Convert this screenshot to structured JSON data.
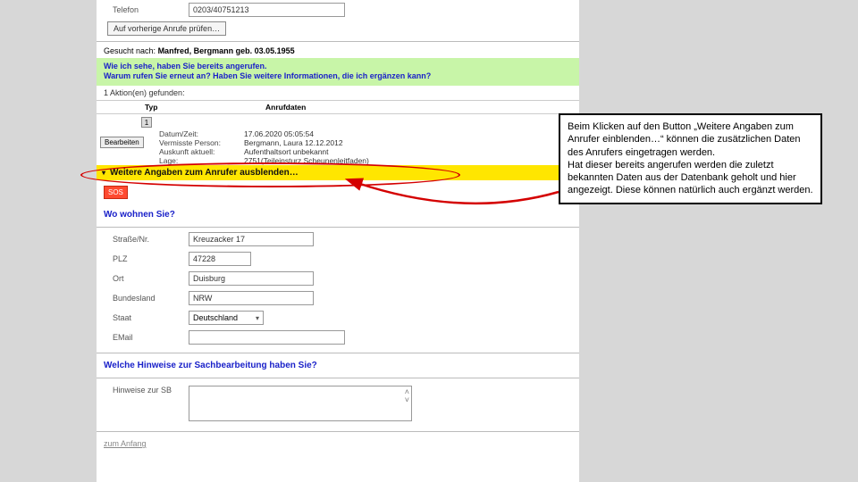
{
  "telefon": {
    "label": "Telefon",
    "value": "0203/40751213"
  },
  "prev_calls_btn": "Auf vorherige Anrufe prüfen…",
  "gesucht_prefix": "Gesucht nach:",
  "gesucht_value": "Manfred, Bergmann geb. 03.05.1955",
  "green_line1": "Wie ich sehe, haben Sie bereits angerufen.",
  "green_line2": "Warum rufen Sie erneut an? Haben Sie weitere Informationen, die ich ergänzen kann?",
  "found_count": "1 Aktion(en) gefunden:",
  "headers": {
    "typ": "Typ",
    "anrufdaten": "Anrufdaten"
  },
  "bearbeiten": "Bearbeiten",
  "detail_icon": "1",
  "details": {
    "datum_k": "Datum/Zeit:",
    "datum_v": "17.06.2020 05:05:54",
    "verm_k": "Vermisste Person:",
    "verm_v": "Bergmann, Laura 12.12.2012",
    "ausk_k": "Auskunft aktuell:",
    "ausk_v": "Aufenthaltsort unbekannt",
    "lage_k": "Lage:",
    "lage_v": "2751(Teileinsturz Scheunenleitfaden)"
  },
  "yellow_label": "Weitere Angaben zum Anrufer ausblenden…",
  "sos": "SOS",
  "section_wohnen": "Wo wohnen Sie?",
  "addr": {
    "strasse_k": "Straße/Nr.",
    "strasse_v": "Kreuzacker 17",
    "plz_k": "PLZ",
    "plz_v": "47228",
    "ort_k": "Ort",
    "ort_v": "Duisburg",
    "land_k": "Bundesland",
    "land_v": "NRW",
    "staat_k": "Staat",
    "staat_v": "Deutschland",
    "email_k": "EMail",
    "email_v": ""
  },
  "section_hinweise": "Welche Hinweise zur Sachbearbeitung haben Sie?",
  "hinweise_k": "Hinweise zur SB",
  "zum_anfang": "zum Anfang",
  "callout": "Beim Klicken auf den Button „Weitere Angaben zum Anrufer einblenden…“ können die zusätzlichen Daten des Anrufers eingetragen werden.\nHat dieser bereits angerufen werden die zuletzt bekannten Daten aus der Datenbank geholt und hier angezeigt. Diese können natürlich auch ergänzt werden."
}
